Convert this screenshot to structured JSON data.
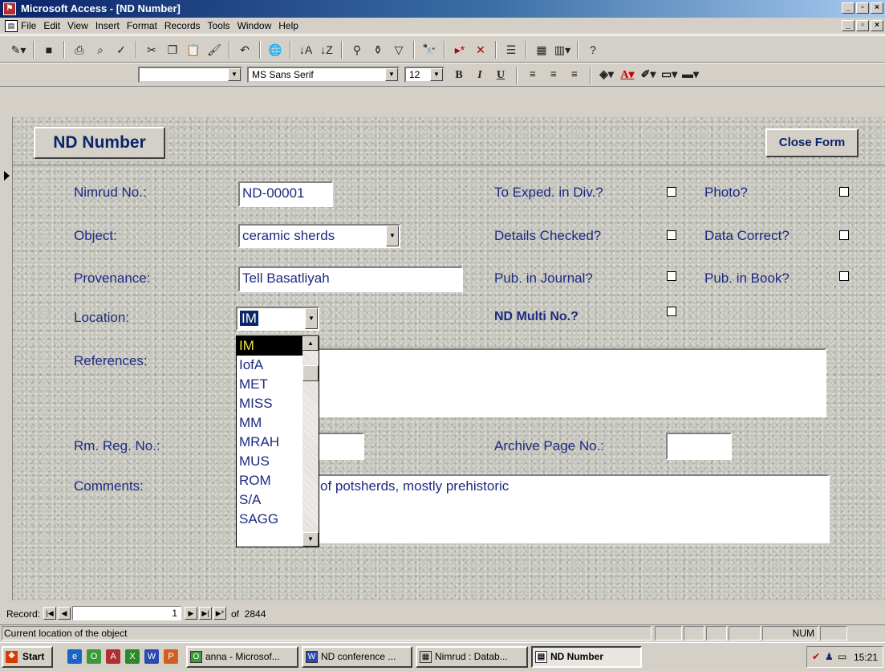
{
  "window": {
    "title": "Microsoft Access - [ND Number]"
  },
  "menu": [
    "File",
    "Edit",
    "View",
    "Insert",
    "Format",
    "Records",
    "Tools",
    "Window",
    "Help"
  ],
  "toolbar": {
    "icons": [
      "view-icon",
      "save-icon",
      "print-icon",
      "print-preview-icon",
      "spelling-icon",
      "cut-icon",
      "copy-icon",
      "paste-icon",
      "format-painter-icon",
      "undo-icon",
      "hyperlink-icon",
      "sort-ascending-icon",
      "sort-descending-icon",
      "filter-by-selection-icon",
      "filter-by-form-icon",
      "apply-filter-icon",
      "find-icon",
      "new-record-icon",
      "delete-record-icon",
      "properties-icon",
      "database-window-icon",
      "new-object-icon",
      "help-icon"
    ],
    "object_combo": "",
    "font_name": "MS Sans Serif",
    "font_size": "12",
    "format_buttons": [
      "B",
      "I",
      "U"
    ]
  },
  "form": {
    "title_button": "ND Number",
    "close_button": "Close Form",
    "fields": {
      "nimrud_no_label": "Nimrud No.:",
      "nimrud_no_value": "ND-00001",
      "object_label": "Object:",
      "object_value": "ceramic sherds",
      "provenance_label": "Provenance:",
      "provenance_value": "Tell Basatliyah",
      "location_label": "Location:",
      "location_value": "IM",
      "references_label": "References:",
      "references_value": "",
      "rm_reg_label": "Rm. Reg. No.:",
      "rm_reg_value": "",
      "archive_page_label": "Archive Page No.:",
      "archive_page_value": "",
      "comments_label": "Comments:",
      "comments_value": "of potsherds, mostly prehistoric"
    },
    "checkboxes": {
      "to_exped": "To Exped. in Div.?",
      "photo": "Photo?",
      "details_checked": "Details Checked?",
      "data_correct": "Data Correct?",
      "pub_journal": "Pub. in Journal?",
      "pub_book": "Pub. in Book?",
      "nd_multi": "ND Multi No.?"
    },
    "location_options": [
      "IM",
      "IofA",
      "MET",
      "MISS",
      "MM",
      "MRAH",
      "MUS",
      "ROM",
      "S/A",
      "SAGG"
    ],
    "location_selected": "IM"
  },
  "navigation": {
    "label": "Record:",
    "current": "1",
    "total_text": "of  2844"
  },
  "status": {
    "text": "Current location of the object",
    "num": "NUM"
  },
  "taskbar": {
    "start": "Start",
    "buttons": [
      "anna - Microsof...",
      "ND conference ...",
      "Nimrud : Datab...",
      "ND Number"
    ],
    "clock": "15:21"
  }
}
